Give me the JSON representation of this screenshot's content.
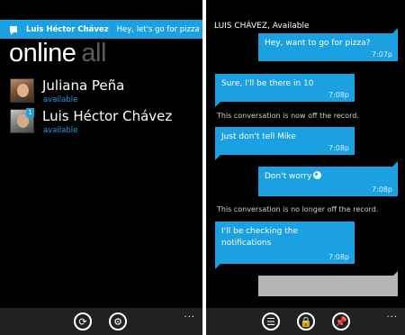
{
  "left_screen": {
    "toast": {
      "name": "Luis Héctor Chávez",
      "message": "Hey, let's go for pizza"
    },
    "pivot": {
      "active": "online",
      "inactive": "all"
    },
    "contacts": [
      {
        "name": "Juliana Peña",
        "status": "available"
      },
      {
        "name": "Luis Héctor Chávez",
        "status": "available",
        "unread": "1"
      }
    ],
    "appbar": {
      "refresh_icon": "refresh-icon",
      "settings_icon": "gear-icon",
      "more": "..."
    }
  },
  "right_screen": {
    "title": "LUIS CHÁVEZ, Available",
    "messages": [
      {
        "text": "Hey, want to go for pizza?",
        "time": "7:07p"
      },
      {
        "text": "Sure, I'll be there in 10",
        "time": "7:08p"
      },
      {
        "text": "Just don't tell Mike",
        "time": "7:08p"
      },
      {
        "text": "Don't worry",
        "time": "7:08p"
      },
      {
        "text_line1": "I'll be checking the",
        "text_line2": "notifications",
        "time": "7:08p"
      }
    ],
    "notices": [
      "This conversation is now off the record.",
      "This conversation is no longer off the record."
    ],
    "input_value": "",
    "appbar": {
      "more": "..."
    }
  },
  "colors": {
    "accent": "#1ba1e2",
    "background": "#000000",
    "appbar": "#212121",
    "inactive_text": "#5c5c5c"
  }
}
